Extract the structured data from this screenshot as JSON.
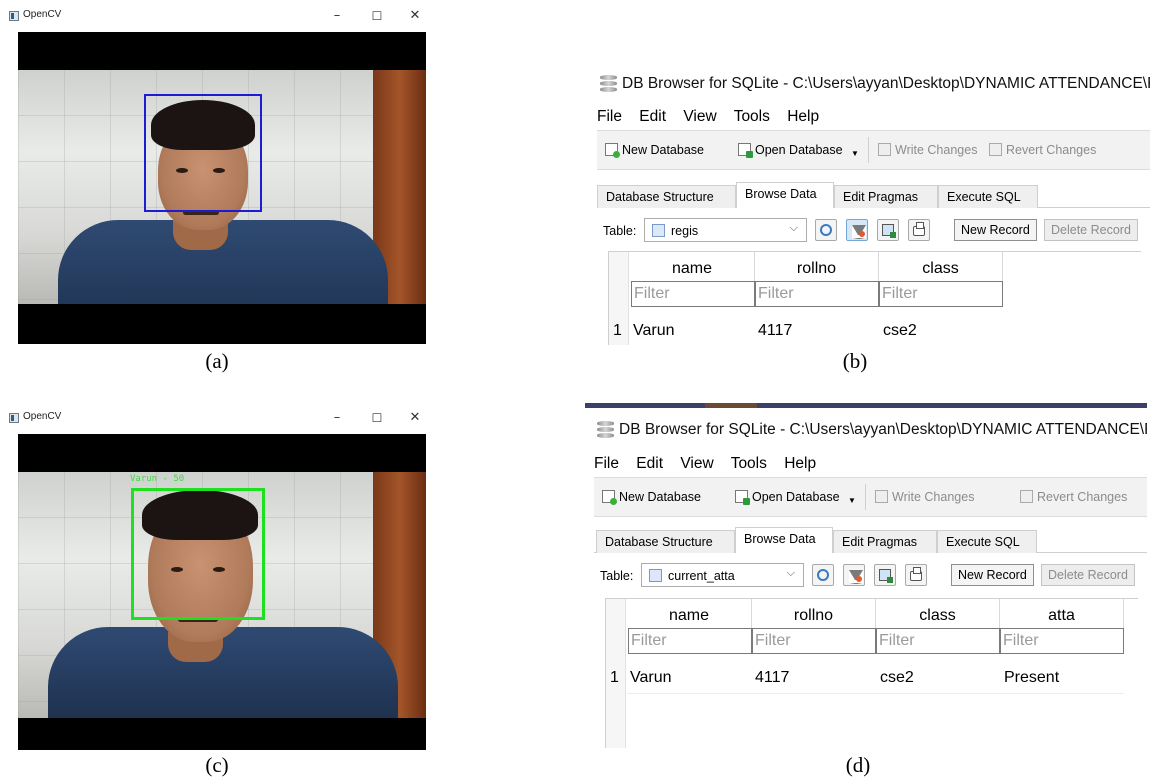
{
  "captions": [
    "(a)",
    "(b)",
    "(c)",
    "(d)"
  ],
  "opencv_windows": [
    {
      "title": "OpenCV",
      "face_label": ""
    },
    {
      "title": "OpenCV",
      "face_label": "Varun - 50"
    }
  ],
  "window_controls": {
    "minimize": "–",
    "maximize": "☐",
    "close": "✕"
  },
  "db_windows": [
    {
      "title": "DB Browser for SQLite - C:\\Users\\ayyan\\Desktop\\DYNAMIC ATTENDANCE\\Face\\",
      "menu": [
        "File",
        "Edit",
        "View",
        "Tools",
        "Help"
      ],
      "toolbar": {
        "new_database": "New Database",
        "open_database": "Open Database",
        "write_changes": "Write Changes",
        "revert_changes": "Revert Changes"
      },
      "tabs": [
        "Database Structure",
        "Browse Data",
        "Edit Pragmas",
        "Execute SQL"
      ],
      "active_tab": "Browse Data",
      "table_label": "Table:",
      "table_name": "regis",
      "new_record": "New Record",
      "delete_record": "Delete Record",
      "columns": [
        "name",
        "rollno",
        "class"
      ],
      "filter_placeholder": "Filter",
      "rows": [
        {
          "num": "1",
          "cells": [
            "Varun",
            "4117",
            "cse2"
          ]
        }
      ]
    },
    {
      "title": "DB Browser for SQLite - C:\\Users\\ayyan\\Desktop\\DYNAMIC ATTENDANCE\\Face\\",
      "menu": [
        "File",
        "Edit",
        "View",
        "Tools",
        "Help"
      ],
      "toolbar": {
        "new_database": "New Database",
        "open_database": "Open Database",
        "write_changes": "Write Changes",
        "revert_changes": "Revert Changes"
      },
      "tabs": [
        "Database Structure",
        "Browse Data",
        "Edit Pragmas",
        "Execute SQL"
      ],
      "active_tab": "Browse Data",
      "table_label": "Table:",
      "table_name": "current_atta",
      "new_record": "New Record",
      "delete_record": "Delete Record",
      "columns": [
        "name",
        "rollno",
        "class",
        "atta"
      ],
      "filter_placeholder": "Filter",
      "rows": [
        {
          "num": "1",
          "cells": [
            "Varun",
            "4117",
            "cse2",
            "Present"
          ]
        }
      ]
    }
  ],
  "colors": {
    "face_box_detect": "#1c1cd2",
    "face_box_recognized": "#1fe01f",
    "label_text": "#3ddc3d",
    "window_top_strip": "#3c3f6a"
  }
}
